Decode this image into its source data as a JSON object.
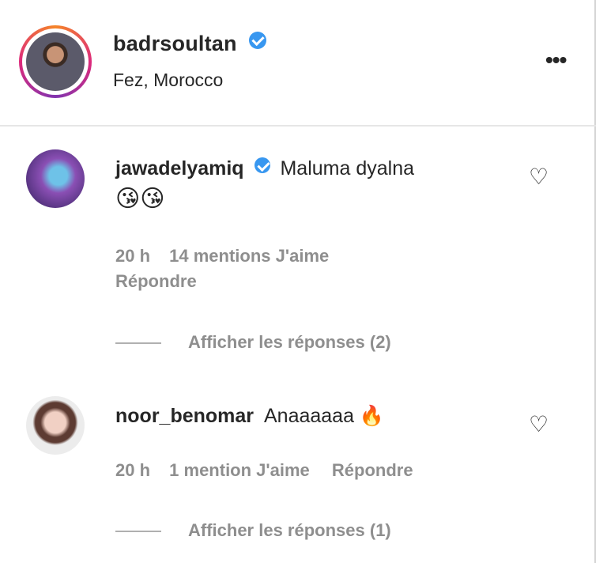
{
  "post_header": {
    "username": "badrsoultan",
    "location": "Fez, Morocco",
    "more_glyph": "•••",
    "verified": true
  },
  "comments": [
    {
      "username": "jawadelyamiq",
      "verified": true,
      "text": "Maluma dyalna",
      "emojis": "😘😘",
      "time": "20 h",
      "likes": "14 mentions J'aime",
      "reply": "Répondre",
      "view_replies": "Afficher les réponses (2)"
    },
    {
      "username": "noor_benomar",
      "verified": false,
      "text": "Anaaaaaa 🔥",
      "time": "20 h",
      "likes": "1 mention J'aime",
      "reply": "Répondre",
      "view_replies": "Afficher les réponses (1)"
    }
  ],
  "icons": {
    "like": "heart-outline-icon",
    "verified": "verified-badge-icon",
    "more": "more-options-icon"
  },
  "colors": {
    "verified": "#3897f0",
    "meta_text": "#8e8e8e",
    "story_ring": "#dd2a7b"
  }
}
